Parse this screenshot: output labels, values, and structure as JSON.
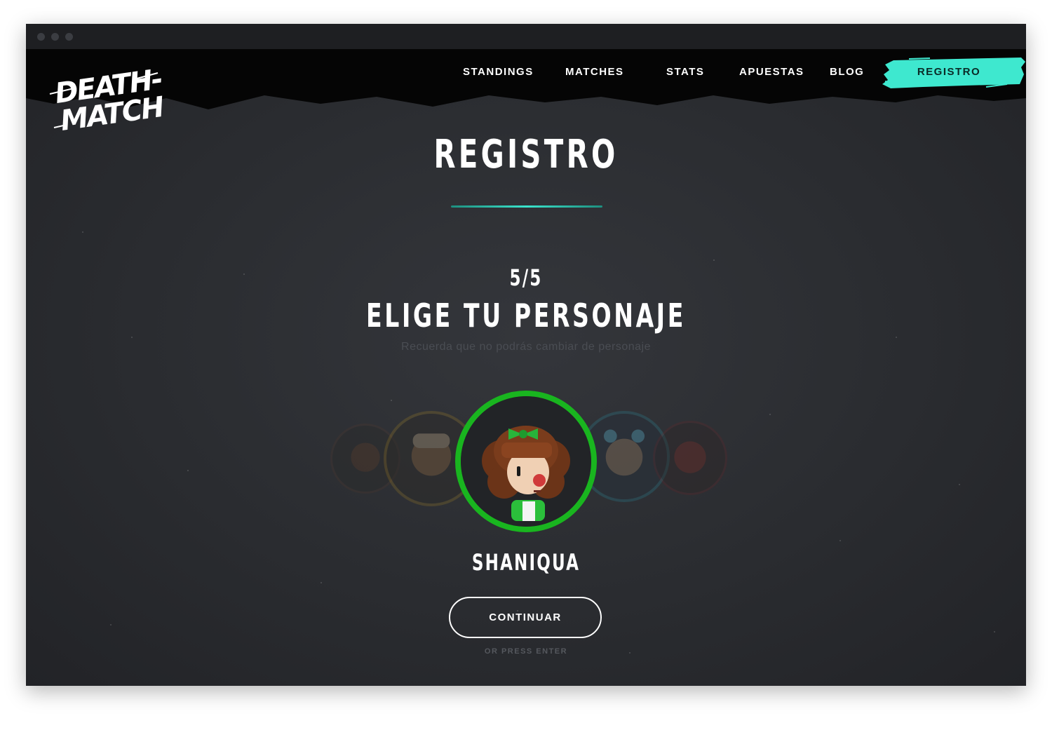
{
  "nav": {
    "items": [
      {
        "label": "STANDINGS"
      },
      {
        "label": "MATCHES"
      },
      {
        "label": "STATS"
      },
      {
        "label": "APUESTAS"
      },
      {
        "label": "BLOG"
      }
    ],
    "cta_label": "REGISTRO",
    "cta_color": "#3ee8cf",
    "logo_text": "DEATH-MATCH"
  },
  "main": {
    "title": "REGISTRO",
    "step": "5/5",
    "heading": "ELIGE TU PERSONAJE",
    "subheading": "Recuerda que no podrás cambiar de personaje",
    "selected_character": "SHANIQUA",
    "continue_label": "CONTINUAR",
    "hint": "OR PRESS ENTER"
  },
  "colors": {
    "accent": "#3ee8cf",
    "selected_ring": "#19b51f",
    "background": "#2b2d31"
  }
}
